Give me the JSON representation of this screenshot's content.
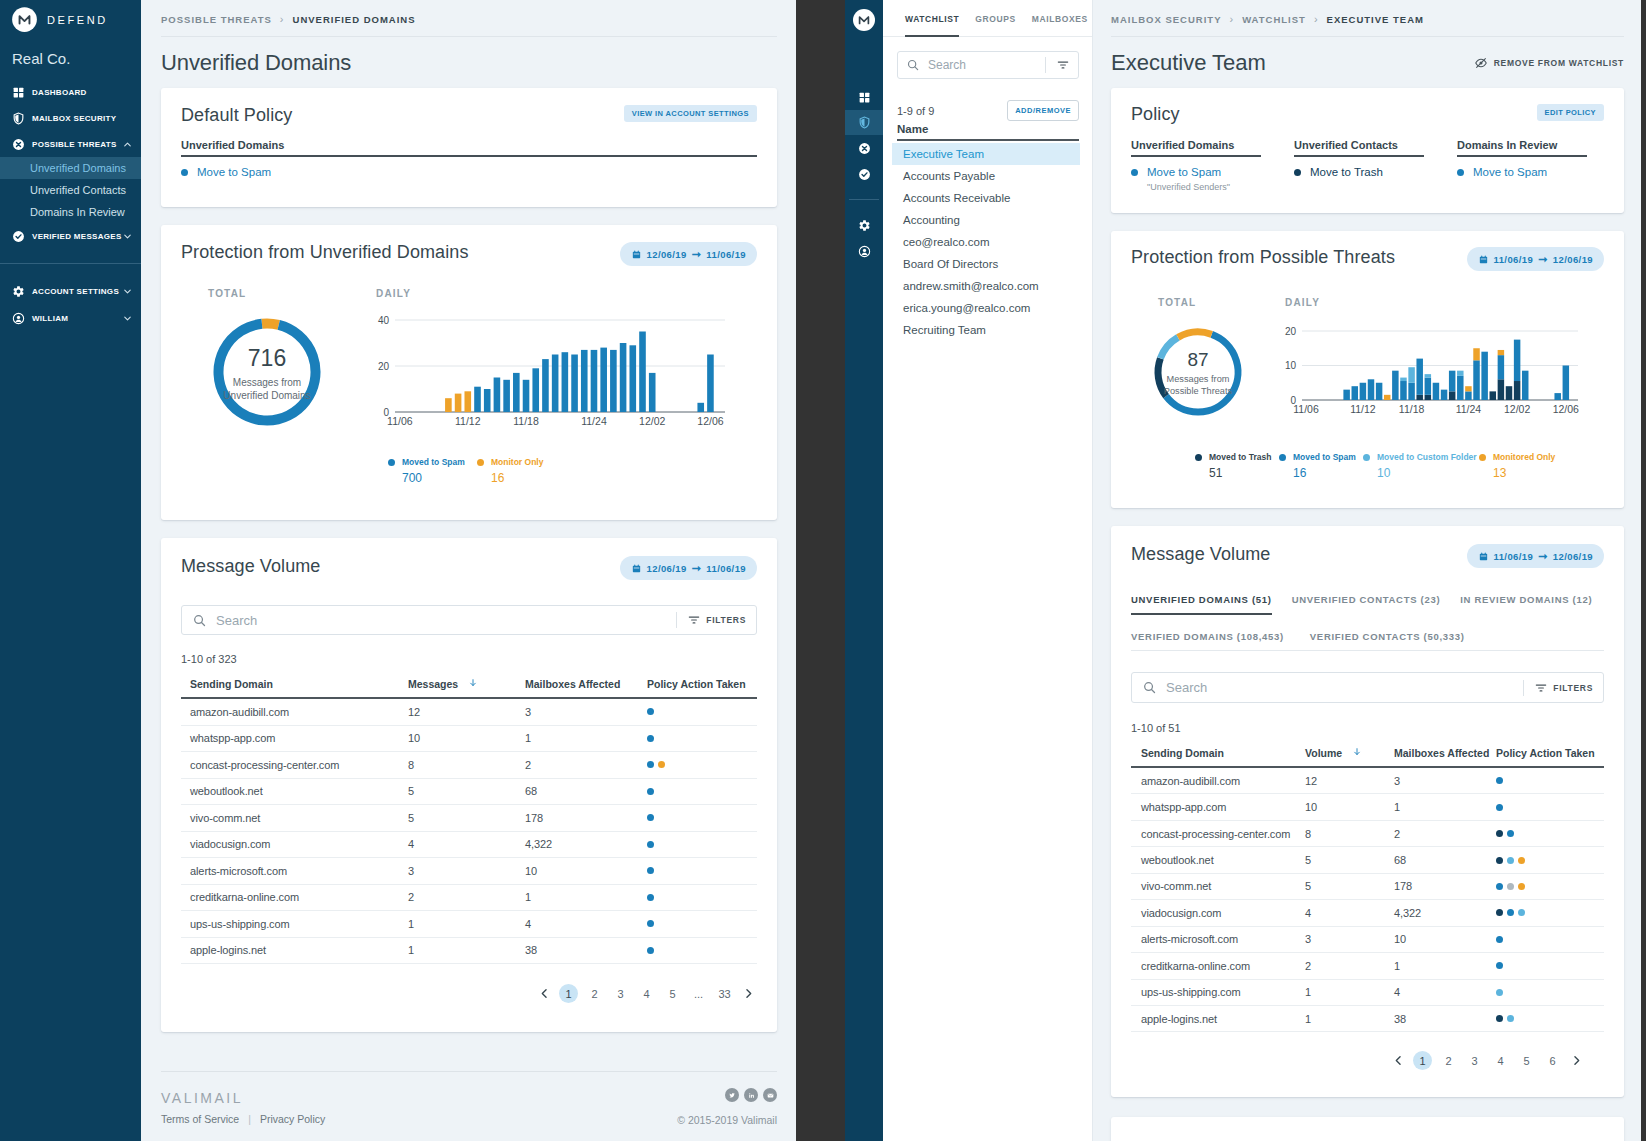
{
  "palette": {
    "navy": "#123F5D",
    "blue": "#1A7FBA",
    "light": "#5CB4DD",
    "orange": "#EEA229",
    "gray": "#AEB8BF",
    "sidebar_bg": "#0C405E",
    "content_bg": "#EEF3F7",
    "chip_bg": "#D9EAF7",
    "active_row_bg": "#D9EDF9",
    "grid_line": "#E0E5E9",
    "axis_line": "#5B6770"
  },
  "left": {
    "brand": {
      "wordmark": "DEFEND",
      "org": "Real Co."
    },
    "sidebar": {
      "items": [
        {
          "icon": "grid-icon",
          "label": "DASHBOARD"
        },
        {
          "icon": "shield-icon",
          "label": "MAILBOX SECURITY"
        },
        {
          "icon": "x-circle-icon",
          "label": "POSSIBLE THREATS",
          "chevron": "up",
          "children": [
            {
              "label": "Unverified Domains",
              "active": true
            },
            {
              "label": "Unverified Contacts"
            },
            {
              "label": "Domains In Review"
            }
          ]
        },
        {
          "icon": "check-circle-icon",
          "label": "VERIFIED MESSAGES",
          "chevron": "down"
        }
      ],
      "bottom_items": [
        {
          "icon": "gear-icon",
          "label": "ACCOUNT SETTINGS",
          "chevron": "down"
        },
        {
          "icon": "person-icon",
          "label": "WILLIAM",
          "chevron": "down"
        }
      ]
    },
    "breadcrumb": [
      "POSSIBLE THREATS",
      "UNVERIFIED DOMAINS"
    ],
    "page_title": "Unverified Domains",
    "default_policy": {
      "title": "Default Policy",
      "button": "VIEW IN ACCOUNT SETTINGS",
      "section": "Unverified Domains",
      "action": "Move to Spam",
      "action_color": "blue"
    },
    "protection": {
      "title": "Protection from Unverified Domains",
      "date_from": "12/06/19",
      "date_to": "11/06/19",
      "total_label": "TOTAL",
      "daily_label": "DAILY",
      "donut_value": "716",
      "donut_caption": "Messages from Unverified Domains",
      "legend": [
        {
          "label": "Moved to Spam",
          "value": "700",
          "color": "blue"
        },
        {
          "label": "Monitor Only",
          "value": "16",
          "color": "orange"
        }
      ]
    },
    "message_volume": {
      "title": "Message Volume",
      "date_from": "12/06/19",
      "date_to": "11/06/19",
      "search_placeholder": "Search",
      "filters_label": "FILTERS",
      "count": "1-10 of 323",
      "columns": [
        "Sending Domain",
        "Messages",
        "Mailboxes Affected",
        "Policy Action Taken"
      ],
      "sorted_column": "Messages",
      "rows": [
        {
          "domain": "amazon-audibill.com",
          "messages": "12",
          "mailboxes": "3",
          "dots": [
            "blue"
          ]
        },
        {
          "domain": "whatspp-app.com",
          "messages": "10",
          "mailboxes": "1",
          "dots": [
            "blue"
          ]
        },
        {
          "domain": "concast-processing-center.com",
          "messages": "8",
          "mailboxes": "2",
          "dots": [
            "blue",
            "orange"
          ]
        },
        {
          "domain": "weboutlook.net",
          "messages": "5",
          "mailboxes": "68",
          "dots": [
            "blue"
          ]
        },
        {
          "domain": "vivo-comm.net",
          "messages": "5",
          "mailboxes": "178",
          "dots": [
            "blue"
          ]
        },
        {
          "domain": "viadocusign.com",
          "messages": "4",
          "mailboxes": "4,322",
          "dots": [
            "blue"
          ]
        },
        {
          "domain": "alerts-microsoft.com",
          "messages": "3",
          "mailboxes": "10",
          "dots": [
            "blue"
          ]
        },
        {
          "domain": "creditkarna-online.com",
          "messages": "2",
          "mailboxes": "1",
          "dots": [
            "blue"
          ]
        },
        {
          "domain": "ups-us-shipping.com",
          "messages": "1",
          "mailboxes": "4",
          "dots": [
            "blue"
          ]
        },
        {
          "domain": "apple-logins.net",
          "messages": "1",
          "mailboxes": "38",
          "dots": [
            "blue"
          ]
        }
      ],
      "pagination": {
        "prev": "chevron-left",
        "pages": [
          "1",
          "2",
          "3",
          "4",
          "5",
          "...",
          "33"
        ],
        "active": "1",
        "next": "chevron-right"
      }
    },
    "footer": {
      "logo": "VALIMAIL",
      "links": [
        "Terms of Service",
        "Privacy Policy"
      ],
      "links_sep": "|",
      "copyright": "© 2015-2019 Valimail",
      "social": [
        "twitter-icon",
        "linkedin-icon",
        "email-icon"
      ]
    }
  },
  "right": {
    "rail_icons": [
      {
        "icon": "grid-icon"
      },
      {
        "icon": "shield-icon",
        "active": true
      },
      {
        "icon": "x-circle-icon"
      },
      {
        "icon": "check-circle-icon"
      },
      {
        "divider": true
      },
      {
        "icon": "gear-icon"
      },
      {
        "icon": "person-icon"
      }
    ],
    "watch_panel": {
      "tabs": [
        {
          "label": "WATCHLIST",
          "active": true
        },
        {
          "label": "GROUPS"
        },
        {
          "label": "MAILBOXES"
        }
      ],
      "search_placeholder": "Search",
      "count": "1-9 of 9",
      "button": "ADD/REMOVE",
      "name_header": "Name",
      "items": [
        {
          "label": "Executive Team",
          "active": true
        },
        {
          "label": "Accounts Payable"
        },
        {
          "label": "Accounts Receivable"
        },
        {
          "label": "Accounting"
        },
        {
          "label": "ceo@realco.com"
        },
        {
          "label": "Board Of Directors"
        },
        {
          "label": "andrew.smith@realco.com"
        },
        {
          "label": "erica.young@realco.com"
        },
        {
          "label": "Recruiting Team"
        }
      ]
    },
    "breadcrumb": [
      "MAILBOX SECURITY",
      "WATCHLIST",
      "EXECUTIVE TEAM"
    ],
    "page_title": "Executive Team",
    "remove_link": "REMOVE FROM WATCHLIST",
    "policy": {
      "title": "Policy",
      "button": "EDIT POLICY",
      "columns": [
        {
          "label": "Unverified Domains",
          "action": "Move to Spam",
          "color": "blue",
          "note": "\"Unverified Senders\""
        },
        {
          "label": "Unverified Contacts",
          "action": "Move to Trash",
          "color": "navy"
        },
        {
          "label": "Domains In Review",
          "action": "Move to Spam",
          "color": "blue"
        }
      ]
    },
    "protection": {
      "title": "Protection from Possible Threats",
      "date_from": "11/06/19",
      "date_to": "12/06/19",
      "total_label": "TOTAL",
      "daily_label": "DAILY",
      "donut_value": "87",
      "donut_caption": "Messages from Possible Threats",
      "legend": [
        {
          "label": "Moved to Trash",
          "value": "51",
          "color": "navy"
        },
        {
          "label": "Moved to Spam",
          "value": "16",
          "color": "blue"
        },
        {
          "label": "Moved to Custom Folder",
          "value": "10",
          "color": "light"
        },
        {
          "label": "Monitored Only",
          "value": "13",
          "color": "orange"
        }
      ]
    },
    "message_volume": {
      "title": "Message Volume",
      "date_from": "11/06/19",
      "date_to": "12/06/19",
      "tabs_row1": [
        {
          "label": "UNVERIFIED DOMAINS (51)",
          "active": true
        },
        {
          "label": "UNVERIFIED CONTACTS (23)"
        },
        {
          "label": "IN REVIEW DOMAINS (12)"
        }
      ],
      "tabs_row2": [
        {
          "label": "VERIFIED DOMAINS (108,453)"
        },
        {
          "label": "VERIFIED CONTACTS (50,333)"
        }
      ],
      "search_placeholder": "Search",
      "filters_label": "FILTERS",
      "count": "1-10 of 51",
      "columns": [
        "Sending Domain",
        "Volume",
        "Mailboxes Affected",
        "Policy Action Taken"
      ],
      "sorted_column": "Volume",
      "rows": [
        {
          "domain": "amazon-audibill.com",
          "messages": "12",
          "mailboxes": "3",
          "dots": [
            "blue"
          ]
        },
        {
          "domain": "whatspp-app.com",
          "messages": "10",
          "mailboxes": "1",
          "dots": [
            "blue"
          ]
        },
        {
          "domain": "concast-processing-center.com",
          "messages": "8",
          "mailboxes": "2",
          "dots": [
            "navy",
            "blue"
          ]
        },
        {
          "domain": "weboutlook.net",
          "messages": "5",
          "mailboxes": "68",
          "dots": [
            "navy",
            "light",
            "orange"
          ]
        },
        {
          "domain": "vivo-comm.net",
          "messages": "5",
          "mailboxes": "178",
          "dots": [
            "blue",
            "gray",
            "orange"
          ]
        },
        {
          "domain": "viadocusign.com",
          "messages": "4",
          "mailboxes": "4,322",
          "dots": [
            "navy",
            "blue",
            "light"
          ]
        },
        {
          "domain": "alerts-microsoft.com",
          "messages": "3",
          "mailboxes": "10",
          "dots": [
            "blue"
          ]
        },
        {
          "domain": "creditkarna-online.com",
          "messages": "2",
          "mailboxes": "1",
          "dots": [
            "blue"
          ]
        },
        {
          "domain": "ups-us-shipping.com",
          "messages": "1",
          "mailboxes": "4",
          "dots": [
            "light"
          ]
        },
        {
          "domain": "apple-logins.net",
          "messages": "1",
          "mailboxes": "38",
          "dots": [
            "navy",
            "light"
          ]
        }
      ],
      "pagination": {
        "prev": "chevron-left",
        "pages": [
          "1",
          "2",
          "3",
          "4",
          "5",
          "6"
        ],
        "active": "1",
        "next": "chevron-right"
      }
    }
  },
  "chart_data": [
    {
      "id": "left_daily_bars",
      "type": "bar",
      "title": "Protection from Unverified Domains — DAILY",
      "xlabel": "",
      "ylabel": "",
      "ylim": [
        0,
        40
      ],
      "yticks": [
        0,
        20,
        40
      ],
      "n_slots": 34,
      "x_ticks": [
        {
          "slot": 0,
          "label": "11/06"
        },
        {
          "slot": 7,
          "label": "11/12"
        },
        {
          "slot": 13,
          "label": "11/18"
        },
        {
          "slot": 20,
          "label": "11/24"
        },
        {
          "slot": 26,
          "label": "12/02"
        },
        {
          "slot": 32,
          "label": "12/06"
        }
      ],
      "series": [
        {
          "name": "Monitor Only",
          "color": "orange",
          "values": [
            0,
            0,
            0,
            0,
            0,
            6,
            8,
            9,
            0,
            0,
            0,
            0,
            0,
            0,
            0,
            0,
            0,
            0,
            0,
            0,
            0,
            0,
            0,
            0,
            0,
            0,
            0,
            0,
            0,
            0,
            0,
            0,
            0,
            0
          ]
        },
        {
          "name": "Moved to Spam",
          "color": "blue",
          "values": [
            0,
            0,
            0,
            0,
            0,
            0,
            0,
            0,
            11,
            10,
            15,
            14,
            17,
            14,
            19,
            23,
            25,
            26,
            25,
            27,
            27,
            28,
            27,
            30,
            29,
            35,
            17,
            0,
            0,
            0,
            0,
            4,
            25,
            0
          ]
        }
      ],
      "legend_position": "bottom"
    },
    {
      "id": "left_total_donut",
      "type": "pie",
      "title": "Protection from Unverified Domains — TOTAL",
      "center_value": 716,
      "center_caption": "Messages from Unverified Domains",
      "start_deg": -6,
      "slices": [
        {
          "label": "Monitor Only",
          "color": "orange",
          "sweep_deg": 20,
          "value": 16
        },
        {
          "label": "Moved to Spam",
          "color": "blue",
          "sweep_deg": 340,
          "value": 700
        }
      ]
    },
    {
      "id": "right_daily_bars",
      "type": "bar",
      "title": "Protection from Possible Threats — DAILY",
      "xlabel": "",
      "ylabel": "",
      "ylim": [
        0,
        20
      ],
      "yticks": [
        0,
        10,
        20
      ],
      "n_slots": 34,
      "x_ticks": [
        {
          "slot": 0,
          "label": "11/06"
        },
        {
          "slot": 7,
          "label": "11/12"
        },
        {
          "slot": 13,
          "label": "11/18"
        },
        {
          "slot": 20,
          "label": "11/24"
        },
        {
          "slot": 26,
          "label": "12/02"
        },
        {
          "slot": 32,
          "label": "12/06"
        }
      ],
      "series": [
        {
          "name": "Moved to Trash",
          "color": "navy",
          "values": [
            0,
            0,
            0,
            0,
            0,
            0,
            0,
            0,
            0,
            0,
            0,
            0,
            0,
            0,
            1.5,
            1.5,
            0,
            0,
            2.5,
            0,
            0,
            0,
            0,
            2.5,
            6,
            4,
            5.5,
            0,
            0,
            0,
            0,
            0,
            0,
            0
          ]
        },
        {
          "name": "Moved to Spam",
          "color": "blue",
          "values": [
            0,
            0,
            0,
            0,
            0,
            3,
            4,
            5,
            6,
            5,
            0,
            8.5,
            5.5,
            5,
            10.5,
            5,
            5,
            3,
            6,
            7,
            2.5,
            11.5,
            14,
            0,
            7,
            0,
            12,
            8.5,
            0,
            0,
            0,
            2,
            10,
            0
          ]
        },
        {
          "name": "Moved to Custom Folder",
          "color": "light",
          "values": [
            0,
            0,
            0,
            0,
            0,
            0,
            0,
            0,
            0,
            0,
            0,
            0,
            1,
            4.5,
            0,
            1,
            0,
            0,
            0,
            1.5,
            0,
            0,
            0,
            0,
            0,
            0,
            0,
            0,
            0,
            0,
            0,
            0,
            0,
            0
          ]
        },
        {
          "name": "Monitored Only",
          "color": "orange",
          "values": [
            0,
            0,
            0,
            0,
            0,
            0,
            0,
            0,
            0,
            0,
            1.5,
            0,
            0,
            0,
            0,
            0,
            0,
            0,
            0,
            0,
            1.5,
            3.5,
            0,
            0,
            1.5,
            0,
            0,
            0,
            0,
            0,
            0,
            0,
            0,
            0
          ]
        }
      ],
      "legend_position": "bottom"
    },
    {
      "id": "right_total_donut",
      "type": "pie",
      "title": "Protection from Possible Threats — TOTAL",
      "center_value": 87,
      "center_caption": "Messages from Possible Threats",
      "start_deg": 20,
      "slices": [
        {
          "label": "Moved to Spam",
          "color": "blue",
          "sweep_deg": 213,
          "value": 16
        },
        {
          "label": "Moved to Trash",
          "color": "navy",
          "sweep_deg": 57,
          "value": 51
        },
        {
          "label": "Moved to Custom Folder",
          "color": "light",
          "sweep_deg": 40,
          "value": 10
        },
        {
          "label": "Monitored Only",
          "color": "orange",
          "sweep_deg": 50,
          "value": 13
        }
      ]
    }
  ]
}
